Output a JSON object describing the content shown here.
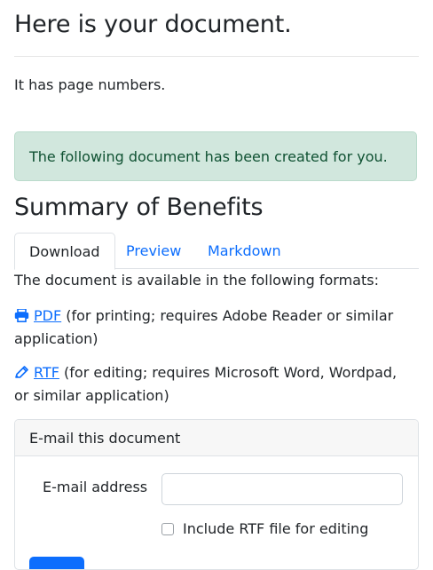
{
  "page": {
    "title": "Here is your document.",
    "subtitle": "It has page numbers."
  },
  "alert": {
    "text": "The following document has been created for you."
  },
  "document": {
    "name": "Summary of Benefits"
  },
  "tabs": [
    {
      "label": "Download",
      "active": true
    },
    {
      "label": "Preview",
      "active": false
    },
    {
      "label": "Markdown",
      "active": false
    }
  ],
  "download": {
    "intro": "The document is available in the following formats:",
    "formats": [
      {
        "icon": "printer-icon",
        "label": "PDF",
        "note": "(for printing; requires Adobe Reader or similar application)"
      },
      {
        "icon": "pencil-icon",
        "label": "RTF",
        "note": "(for editing; requires Microsoft Word, Wordpad, or similar application)"
      }
    ]
  },
  "email": {
    "header": "E-mail this document",
    "address_label": "E-mail address",
    "address_value": "",
    "include_rtf_label": "Include RTF file for editing",
    "include_rtf_checked": false
  },
  "colors": {
    "link": "#0d6efd",
    "alert_bg": "#d1e7dd",
    "alert_text": "#0f5132"
  }
}
